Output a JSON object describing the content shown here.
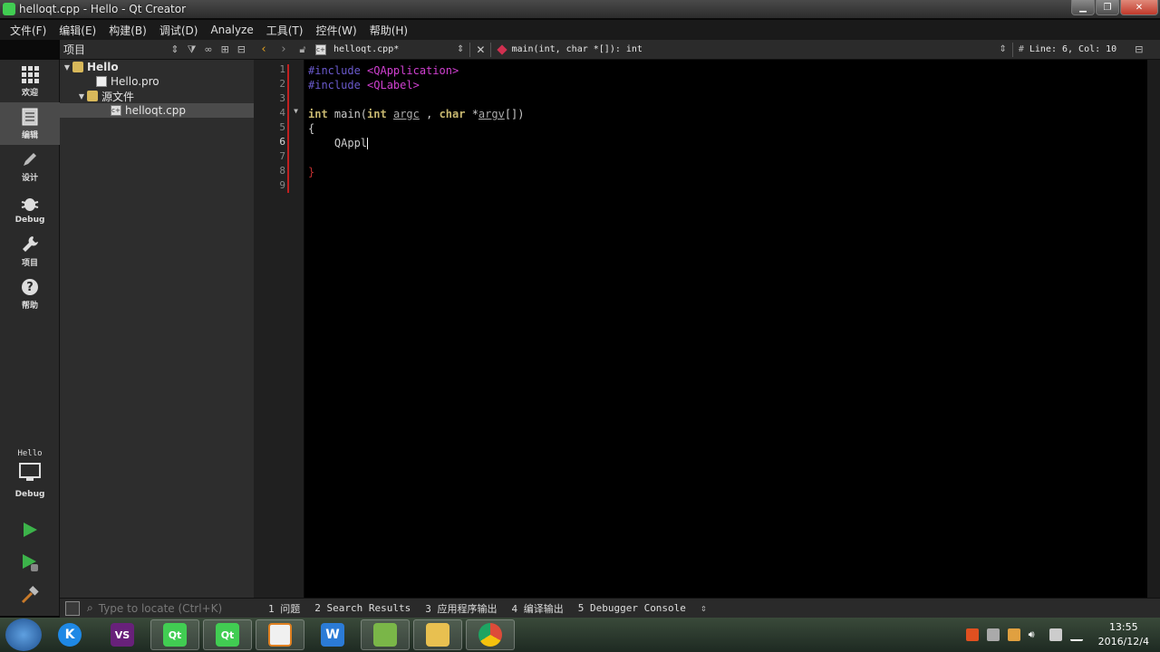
{
  "window": {
    "title": "helloqt.cpp - Hello - Qt Creator"
  },
  "menu": [
    "文件(F)",
    "编辑(E)",
    "构建(B)",
    "调试(D)",
    "Analyze",
    "工具(T)",
    "控件(W)",
    "帮助(H)"
  ],
  "modes": [
    {
      "label": "欢迎",
      "icon": "grid-icon"
    },
    {
      "label": "编辑",
      "icon": "edit-document-icon"
    },
    {
      "label": "设计",
      "icon": "pencil-icon"
    },
    {
      "label": "Debug",
      "icon": "bug-icon"
    },
    {
      "label": "项目",
      "icon": "wrench-icon"
    },
    {
      "label": "帮助",
      "icon": "help-icon"
    }
  ],
  "kit": {
    "project": "Hello",
    "build": "Debug"
  },
  "projects_panel": {
    "title": "项目",
    "tree": {
      "root": "Hello",
      "pro_file": "Hello.pro",
      "sources_folder": "源文件",
      "source_file": "helloqt.cpp"
    }
  },
  "editor_toolbar": {
    "file": "helloqt.cpp*",
    "symbol": "main(int, char *[]): int",
    "position": "Line: 6, Col: 10"
  },
  "editor": {
    "line_numbers": [
      "1",
      "2",
      "3",
      "4",
      "5",
      "6",
      "7",
      "8",
      "9"
    ],
    "code": {
      "l1_pp": "#include",
      "l1_inc": "<QApplication>",
      "l2_pp": "#include",
      "l2_inc": "<QLabel>",
      "l4_kw1": "int",
      "l4_fn": " main(",
      "l4_kw2": "int",
      "l4_p1": "argc",
      "l4_mid": " , ",
      "l4_kw3": "char",
      "l4_star": " *",
      "l4_p2": "argv",
      "l4_end": "[])",
      "l5": "{",
      "l6": "    QAppl",
      "l8": "}"
    }
  },
  "locator": {
    "placeholder": "Type to locate (Ctrl+K)"
  },
  "output_tabs": [
    "1 问题",
    "2 Search Results",
    "3 应用程序输出",
    "4 编译输出",
    "5 Debugger Console"
  ],
  "taskbar": {
    "apps": [
      {
        "name": "K",
        "color": "#1e88e5",
        "icon": "k-app-icon"
      },
      {
        "name": "VS",
        "color": "#68217a",
        "icon": "visual-studio-icon"
      },
      {
        "name": "Qt",
        "color": "#41cd52",
        "icon": "qt-icon"
      },
      {
        "name": "Qt",
        "color": "#41cd52",
        "icon": "qt-creator-icon"
      },
      {
        "name": "",
        "color": "#f0f0f0",
        "icon": "search-app-icon"
      },
      {
        "name": "W",
        "color": "#2b7bd6",
        "icon": "wps-writer-icon"
      },
      {
        "name": "",
        "color": "#7ab648",
        "icon": "audio-editor-icon"
      },
      {
        "name": "",
        "color": "#e8c050",
        "icon": "file-explorer-icon"
      },
      {
        "name": "",
        "color": "#dd4b39",
        "icon": "chrome-icon"
      }
    ],
    "clock": {
      "time": "13:55",
      "date": "2016/12/4"
    }
  }
}
